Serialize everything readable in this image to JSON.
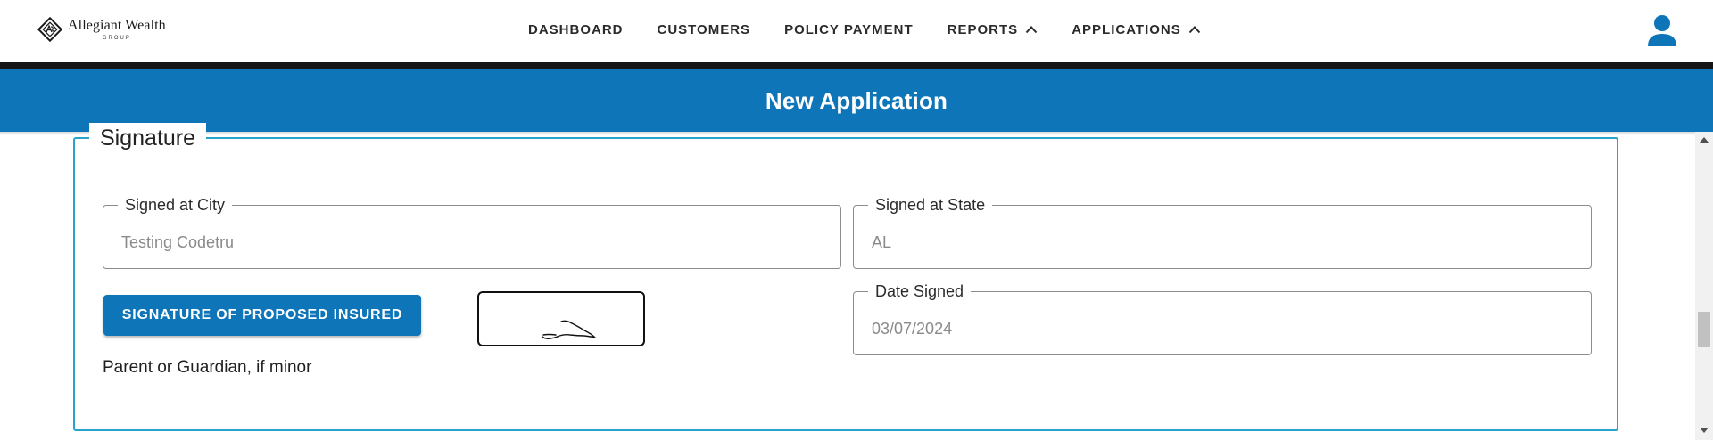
{
  "brand": {
    "name": "Allegiant Wealth",
    "subtitle": "GROUP",
    "logo_icon": "diamond-monogram-icon"
  },
  "nav": {
    "items": [
      {
        "label": "DASHBOARD",
        "icon": null
      },
      {
        "label": "CUSTOMERS",
        "icon": null
      },
      {
        "label": "POLICY PAYMENT",
        "icon": null
      },
      {
        "label": "REPORTS",
        "icon": "chevron-up-icon"
      },
      {
        "label": "APPLICATIONS",
        "icon": "chevron-up-icon"
      }
    ],
    "user_icon": "user-account-icon"
  },
  "page": {
    "title": "New Application"
  },
  "signature_section": {
    "legend": "Signature",
    "signed_at_city": {
      "label": "Signed at City",
      "value": "Testing Codetru"
    },
    "signed_at_state": {
      "label": "Signed at State",
      "value": "AL"
    },
    "date_signed": {
      "label": "Date Signed",
      "value": "03/07/2024"
    },
    "signature_button_label": "SIGNATURE OF PROPOSED INSURED",
    "guardian_note": "Parent or Guardian, if minor"
  },
  "colors": {
    "primary_blue": "#0e75b9",
    "section_border": "#29a3c9",
    "header_strip": "#141414",
    "user_icon": "#0e75b9"
  }
}
